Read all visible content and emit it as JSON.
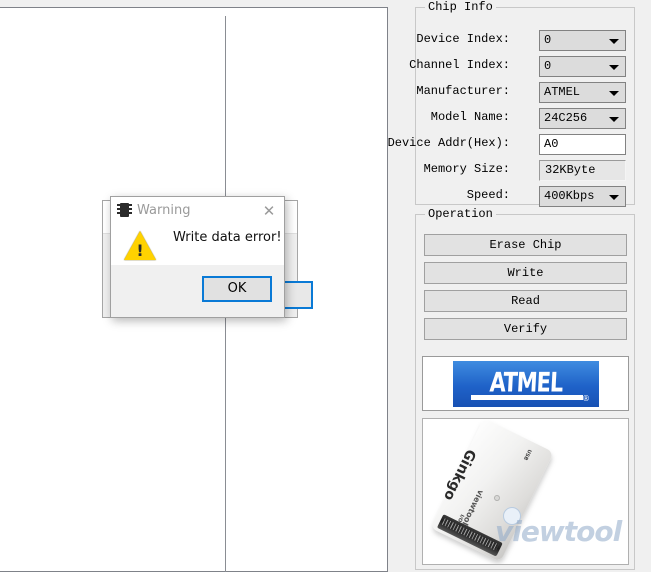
{
  "chip_info": {
    "title": "Chip Info",
    "fields": [
      {
        "label": "Device Index:",
        "value": "0",
        "control": "combo"
      },
      {
        "label": "Channel Index:",
        "value": "0",
        "control": "combo"
      },
      {
        "label": "Manufacturer:",
        "value": "ATMEL",
        "control": "combo"
      },
      {
        "label": "Model Name:",
        "value": "24C256",
        "control": "combo"
      },
      {
        "label": "Device Addr(Hex):",
        "value": "A0",
        "control": "textbox"
      },
      {
        "label": "Memory Size:",
        "value": "32KByte",
        "control": "readonly"
      },
      {
        "label": "Speed:",
        "value": "400Kbps",
        "control": "combo"
      }
    ]
  },
  "operation": {
    "title": "Operation",
    "buttons": [
      {
        "label": "Erase Chip"
      },
      {
        "label": "Write"
      },
      {
        "label": "Read"
      },
      {
        "label": "Verify"
      }
    ],
    "vendor_logo": {
      "text": "ATMEL",
      "registered_mark": "®",
      "gradient_top": "#3f8ce0",
      "gradient_bottom": "#1851b4"
    },
    "device_photo": {
      "product_name": "Ginkgo",
      "brand": "viewtool",
      "usb_port_label": "USB",
      "io_port_label": "I/O",
      "watermark": "viewtool"
    }
  },
  "dialog": {
    "title": "Warning",
    "icon": "chip-icon",
    "close_label": "✕",
    "message": "Write data error!",
    "alert_icon": "warning-triangle-icon",
    "alert_glyph": "!",
    "ok_label": "OK",
    "focus_color": "#0a7ad6",
    "warning_color": "#ffd200"
  }
}
